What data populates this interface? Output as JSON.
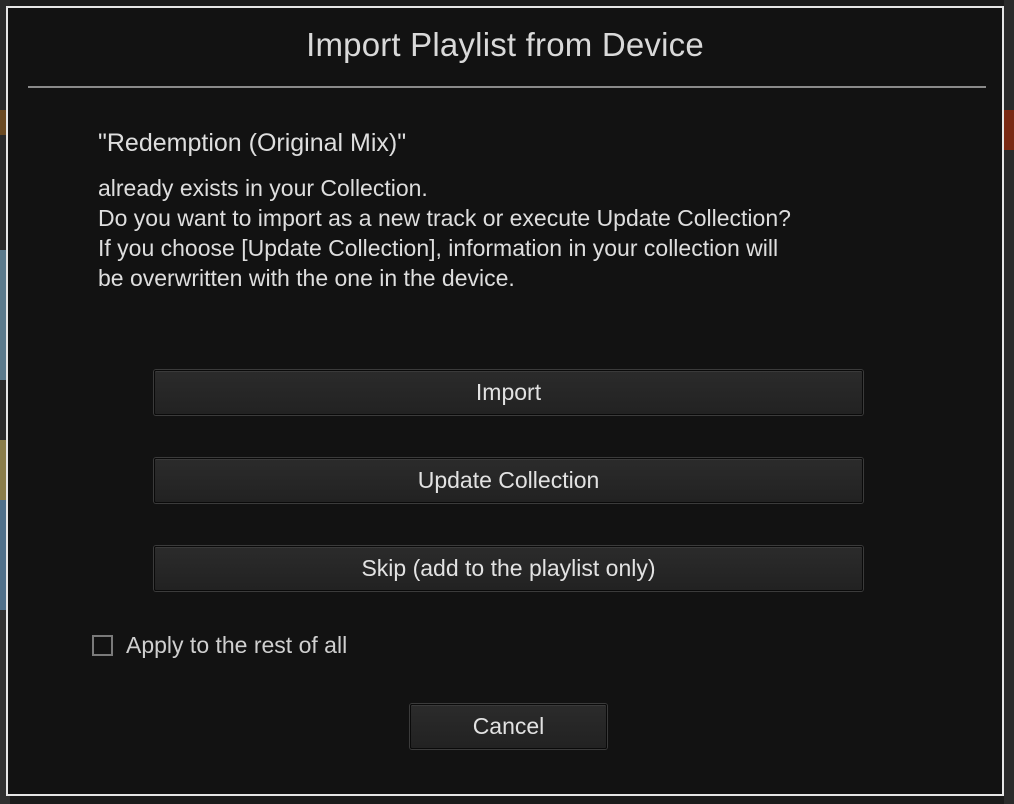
{
  "dialog": {
    "title": "Import Playlist from Device",
    "track_name": "\"Redemption (Original Mix)\"",
    "message_lines": [
      "already exists in your Collection.",
      "Do you want to import as a new track or execute Update Collection?",
      "If you choose [Update Collection], information in your collection will",
      "be overwritten with the one in the device."
    ],
    "buttons": {
      "import": "Import",
      "update_collection": "Update Collection",
      "skip": "Skip (add to the playlist only)",
      "cancel": "Cancel"
    },
    "apply_to_all": {
      "label": "Apply to the rest of all",
      "checked": false
    }
  },
  "colors": {
    "dialog_background": "#121212",
    "dialog_border": "#e6e6e6",
    "text": "#dedede",
    "button_background": "#262626"
  }
}
